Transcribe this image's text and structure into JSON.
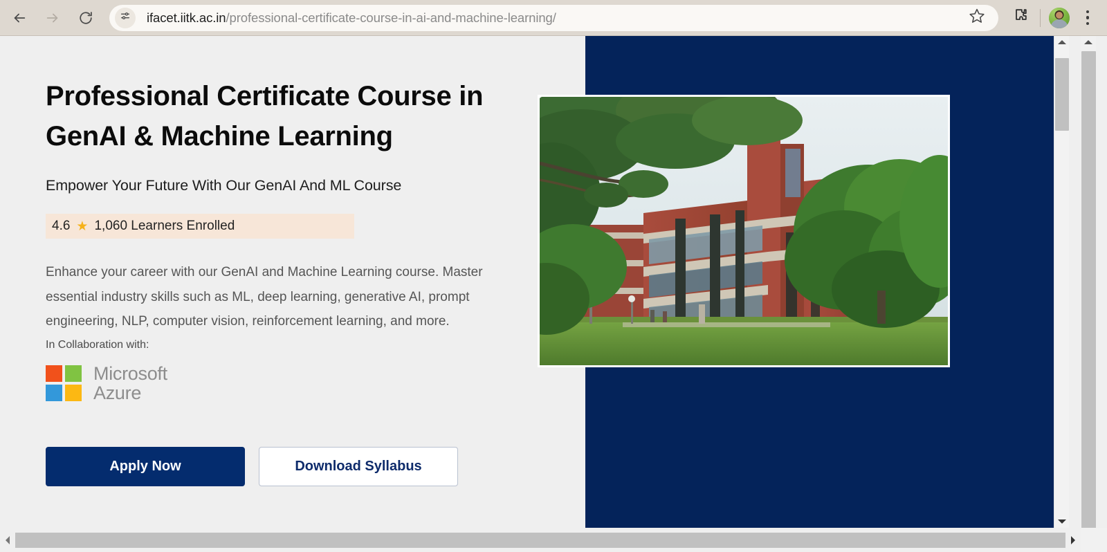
{
  "browser": {
    "back_label": "Back",
    "forward_label": "Forward",
    "reload_label": "Reload",
    "site_info_label": "View site information",
    "url_host": "ifacet.iitk.ac.in",
    "url_path": "/professional-certificate-course-in-ai-and-machine-learning/",
    "bookmark_label": "Bookmark this tab",
    "extensions_label": "Extensions",
    "profile_label": "Profile",
    "menu_label": "Customize and control Google Chrome",
    "toolbar_bg": "#ded8d0",
    "omnibox_bg": "#faf8f5"
  },
  "page": {
    "background": "#efefef",
    "hero": {
      "title": "Professional Certificate Course in GenAI & Machine Learning",
      "subtitle": "Empower Your Future With Our GenAI And ML Course",
      "rating_value": "4.6",
      "star_glyph": "★",
      "star_color": "#f6b21b",
      "enrolled_text": "1,060 Learners Enrolled",
      "badge_bg": "#f7e6d8",
      "description": "Enhance your career with our GenAI and Machine Learning course. Master essential industry skills such as ML, deep learning, generative AI, prompt engineering, NLP, computer vision, reinforcement learning, and more.",
      "collaboration_label": "In Collaboration with:",
      "partner_line1": "Microsoft",
      "partner_line2": "Azure",
      "partner_colors": {
        "red": "#f1511b",
        "green": "#80c342",
        "blue": "#3398da",
        "yellow": "#fcb813"
      },
      "primary_button": "Apply Now",
      "secondary_button": "Download Syllabus",
      "primary_button_color": "#042c6e",
      "secondary_button_text_color": "#0e2b6b",
      "panel_color": "#04235a",
      "image_alt": "IIT Kanpur red-brick academic building with trees"
    }
  },
  "scrollbars": {
    "page_vertical_label": "Page vertical scrollbar",
    "window_vertical_label": "Window vertical scrollbar",
    "horizontal_label": "Horizontal scrollbar",
    "up_arrow": "▲",
    "down_arrow": "▼",
    "left_arrow": "◀",
    "right_arrow": "▶"
  }
}
